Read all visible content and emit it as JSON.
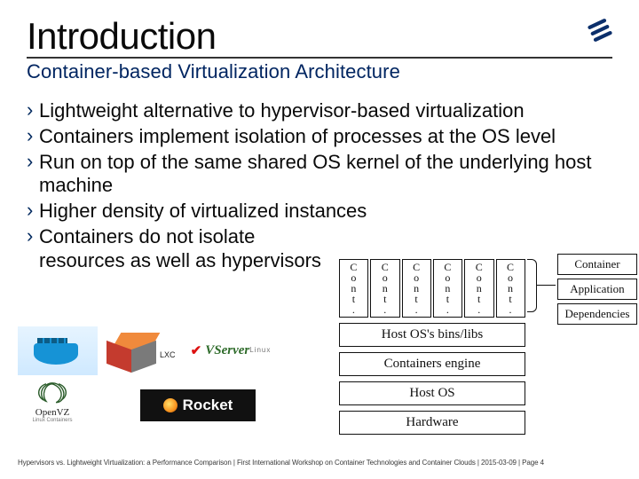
{
  "title": "Introduction",
  "subtitle": "Container-based Virtualization Architecture",
  "bullets": [
    "Lightweight alternative to hypervisor-based virtualization",
    "Containers implement isolation of processes at the OS level",
    "Run on top of the same shared OS kernel of the underlying host machine",
    "Higher density of virtualized instances",
    "Containers do not isolate resources as well as hypervisors"
  ],
  "logos": {
    "docker": "docker",
    "lxc_label": "LXC",
    "vserver_main": "Server",
    "vserver_prefix": "V",
    "vserver_small": "Linux",
    "openvz_main": "OpenVZ",
    "openvz_small": "Linux Containers",
    "rocket": "Rocket"
  },
  "diagram": {
    "cont_cell": "Cont.",
    "cont_count": 6,
    "boxes": [
      "Host OS's bins/libs",
      "Containers engine",
      "Host OS",
      "Hardware"
    ],
    "side": {
      "container": "Container",
      "application": "Application",
      "dependencies": "Dependencies"
    }
  },
  "footer": {
    "left": "Hypervisors vs. Lightweight Virtualization: a Performance Comparison | First International Workshop on Container Technologies and Container Clouds",
    "date": "2015-03-09",
    "page": "Page 4"
  }
}
